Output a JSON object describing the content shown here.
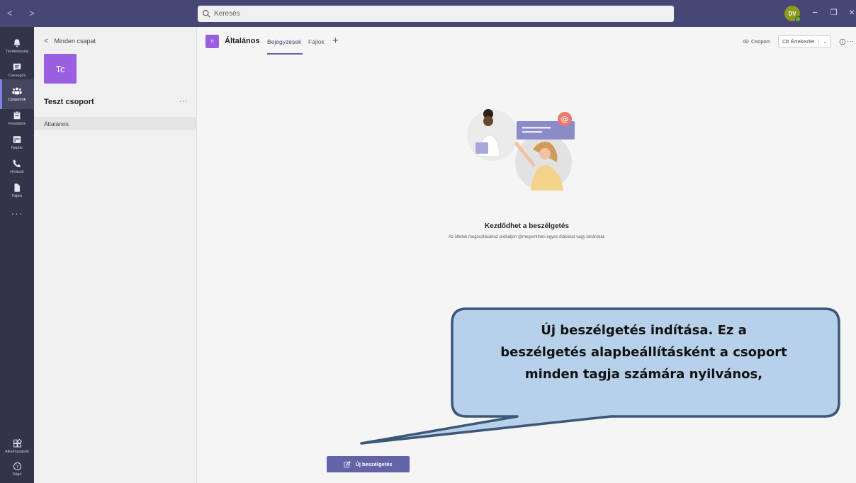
{
  "titlebar": {
    "nav_arrows": "< >",
    "search_placeholder": "Keresés",
    "avatar_initials": "DV",
    "min_glyph": "−",
    "max_glyph": "❐",
    "close_glyph": "×"
  },
  "rail": {
    "items": [
      {
        "label": "Tevékenység",
        "icon": "bell-icon"
      },
      {
        "label": "Csevegés",
        "icon": "chat-icon"
      },
      {
        "label": "Csoportok",
        "icon": "teams-icon"
      },
      {
        "label": "Feladatok",
        "icon": "assignments-icon"
      },
      {
        "label": "Naptár",
        "icon": "calendar-icon"
      },
      {
        "label": "Hívások",
        "icon": "phone-icon"
      },
      {
        "label": "Fájlok",
        "icon": "files-icon"
      }
    ],
    "more": "···",
    "bottom": [
      {
        "label": "Alkalmazások",
        "icon": "apps-icon"
      },
      {
        "label": "Súgó",
        "icon": "help-icon"
      }
    ]
  },
  "panel": {
    "back_label": "Minden csapat",
    "team_initials": "Tc",
    "team_name": "Teszt csoport",
    "more": "···",
    "channel": "Általános"
  },
  "header": {
    "channel_initials": "Tc",
    "channel_title": "Általános",
    "tabs": [
      "Bejegyzések",
      "Fájlok"
    ],
    "add_tab": "+",
    "team_button": "Csoport",
    "meet_button": "Értekezlet",
    "more": "···"
  },
  "empty_state": {
    "title": "Kezdődhet a beszélgetés",
    "subtitle": "Az ötletek megosztásához próbáljon @megemlíteni egyes diákokat vagy tanárokat."
  },
  "new_conversation_label": "Új beszélgetés",
  "callout": {
    "line1": "Új beszélgetés indítása. Ez a",
    "line2": "beszélgetés alapbeállításként a csoport",
    "line3": "minden tagja számára nyilvános,"
  },
  "colors": {
    "titlebar": "#464775",
    "rail": "#33344a",
    "accent": "#6264a7",
    "team_tile": "#9a5fe0",
    "callout_fill": "#b7d1ea",
    "callout_border": "#3c5878"
  }
}
